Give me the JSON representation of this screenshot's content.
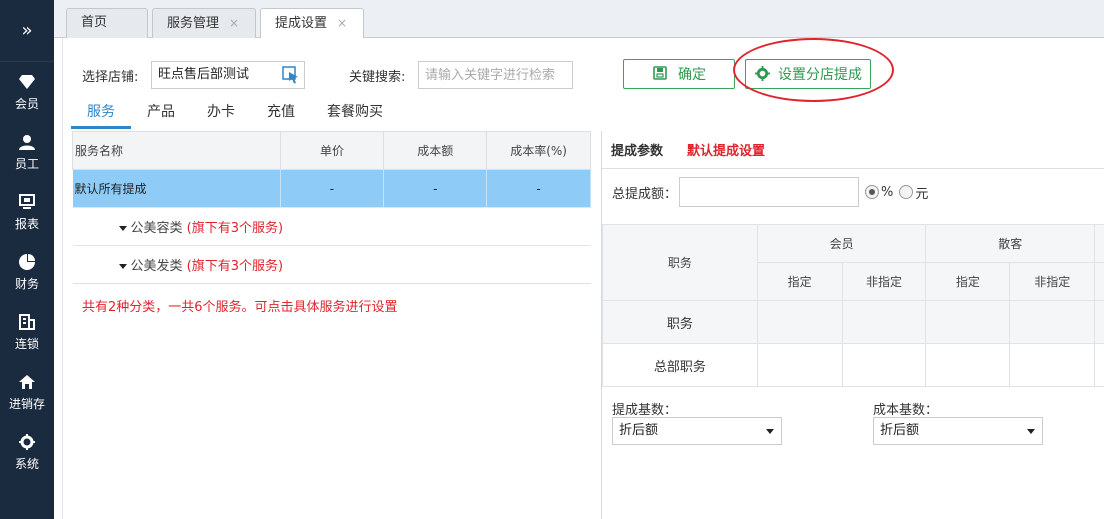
{
  "nav": {
    "toggle_glyph": "»",
    "items": [
      {
        "label": "会员",
        "icon": "diamond-icon"
      },
      {
        "label": "员工",
        "icon": "user-icon"
      },
      {
        "label": "报表",
        "icon": "monitor-icon"
      },
      {
        "label": "财务",
        "icon": "pie-chart-icon"
      },
      {
        "label": "连锁",
        "icon": "building-icon"
      },
      {
        "label": "进销存",
        "icon": "home-icon"
      },
      {
        "label": "系统",
        "icon": "gear-icon"
      }
    ]
  },
  "tabs": [
    {
      "label": "首页"
    },
    {
      "label": "服务管理",
      "close": "×"
    },
    {
      "label": "提成设置",
      "close": "×"
    }
  ],
  "toolbar": {
    "store_label": "选择店铺:",
    "store_value": "旺点售后部测试",
    "keyword_label": "关键搜索:",
    "keyword_placeholder": "请输入关键字进行检索",
    "confirm_label": "确定",
    "branch_label": "设置分店提成"
  },
  "subtabs": [
    "服务",
    "产品",
    "办卡",
    "充值",
    "套餐购买"
  ],
  "service_table": {
    "headers": [
      "服务名称",
      "单价",
      "成本额",
      "成本率(%)"
    ],
    "default_row": {
      "name": "默认所有提成",
      "price": "-",
      "cost": "-",
      "rate": "-"
    },
    "categories": [
      {
        "name": "公美容类",
        "count_text": "(旗下有3个服务)"
      },
      {
        "name": "公美发类",
        "count_text": "(旗下有3个服务)"
      }
    ],
    "note": "共有2种分类，一共6个服务。可点击具体服务进行设置"
  },
  "params": {
    "title": "提成参数",
    "subtitle": "默认提成设置",
    "total_label": "总提成额：",
    "unit_percent": "%",
    "unit_yuan": "元",
    "unit_selected": "percent",
    "col_position": "职务",
    "group_member": "会员",
    "group_walkin": "散客",
    "designated": "指定",
    "non_designated": "非指定",
    "row_position": "职务",
    "row_hq": "总部职务",
    "base_label": "提成基数：",
    "base_value": "折后额",
    "cost_base_label": "成本基数：",
    "cost_base_value": "折后额"
  },
  "colors": {
    "nav_bg": "#1a2a3f",
    "accent_blue": "#2f86c8",
    "selected_row": "#8fcbf7",
    "green": "#2e9a50",
    "red": "#e0242e"
  }
}
